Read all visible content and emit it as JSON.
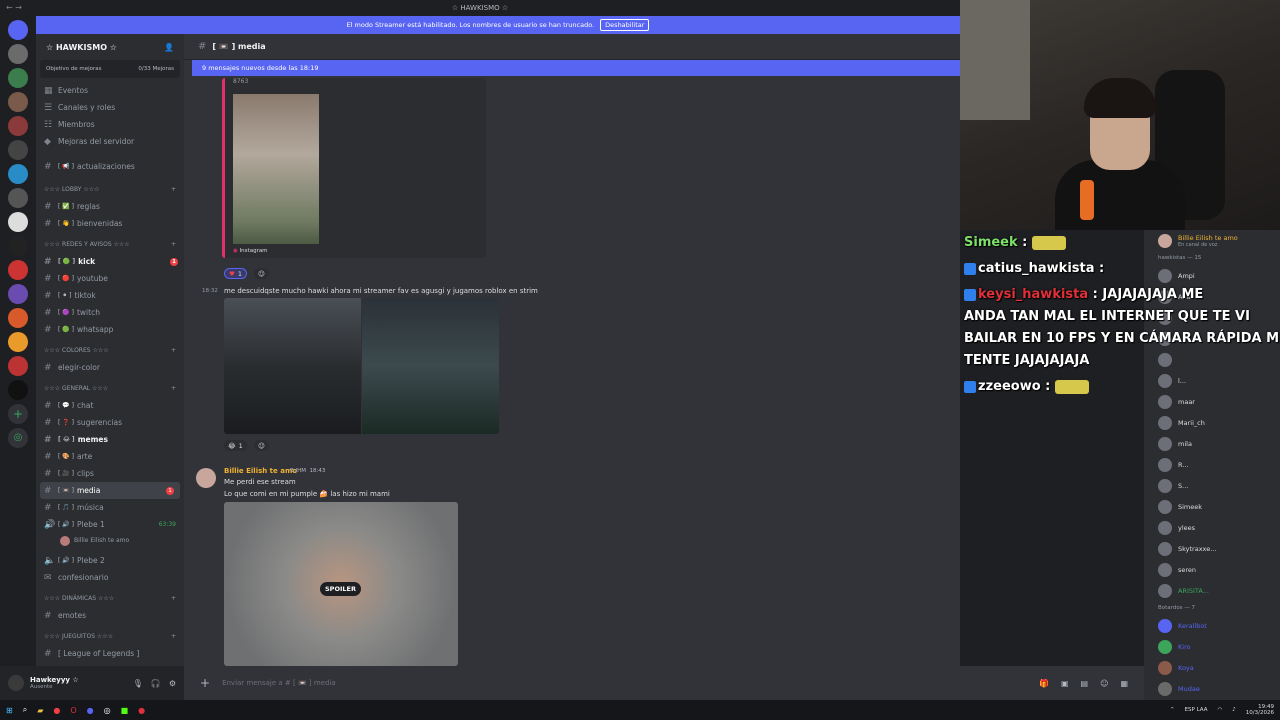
{
  "window": {
    "title": "☆ HAWKISMO ☆"
  },
  "streamer_bar": {
    "text": "El modo Streamer está habilitado. Los nombres de usuario se han truncado.",
    "button": "Deshabilitar"
  },
  "sidebar": {
    "server_name": "☆ HAWKISMO ☆",
    "goal_label": "Objetivo de mejoras",
    "goal_progress": "0/33 Mejoras",
    "menu": [
      "Eventos",
      "Canales y roles",
      "Miembros",
      "Mejoras del servidor"
    ],
    "channels_top": [
      {
        "name": "actualizaciones",
        "emoji": "[ 📢 ]"
      }
    ],
    "categories": [
      {
        "name": "☆☆☆ LOBBY ☆☆☆",
        "channels": [
          {
            "name": "reglas",
            "emoji": "[ ✅ ]"
          },
          {
            "name": "bienvenidas",
            "emoji": "[ 👋 ]"
          }
        ]
      },
      {
        "name": "☆☆☆ REDES Y AVISOS ☆☆☆",
        "channels": [
          {
            "name": "kick",
            "emoji": "[ 🟢 ]",
            "badge": "1"
          },
          {
            "name": "youtube",
            "emoji": "[ 🔴 ]"
          },
          {
            "name": "tiktok",
            "emoji": "[ ⚫ ]"
          },
          {
            "name": "twitch",
            "emoji": "[ 🟣 ]"
          },
          {
            "name": "whatsapp",
            "emoji": "[ 🟢 ]"
          }
        ]
      },
      {
        "name": "☆☆☆ COLORES ☆☆☆",
        "channels": [
          {
            "name": "elegir-color",
            "emoji": ""
          }
        ]
      },
      {
        "name": "☆☆☆ GENERAL ☆☆☆",
        "channels": [
          {
            "name": "chat",
            "emoji": "[ 💬 ]"
          },
          {
            "name": "sugerencias",
            "emoji": "[ ❓ ]"
          },
          {
            "name": "memes",
            "emoji": "[ 😂 ]"
          },
          {
            "name": "arte",
            "emoji": "[ 🎨 ]"
          },
          {
            "name": "clips",
            "emoji": "[ 🎥 ]"
          },
          {
            "name": "media",
            "emoji": "[ 📼 ]",
            "badge": "1"
          },
          {
            "name": "música",
            "emoji": "[ 🎵 ]"
          }
        ]
      }
    ],
    "voice": [
      {
        "name": "Plebe 1",
        "emoji": "[ 🔊 ]",
        "timer": "63:39",
        "member": "Billie Eilish te amo"
      },
      {
        "name": "Plebe 2",
        "emoji": "[ 🔊 ]"
      },
      {
        "name": "confesionario",
        "emoji": ""
      }
    ],
    "cat_dinamicas": "☆☆☆ DINÁMICAS ☆☆☆",
    "ch_emotes": "emotes",
    "cat_juegos": "☆☆☆ JUEGUITOS ☆☆☆",
    "ch_lol": "[ League of Legends ]"
  },
  "user_panel": {
    "name": "Hawkeyyy ☆",
    "status": "Ausente"
  },
  "channel": {
    "name": "[ 📼 ] media",
    "new_messages": "9 mensajes nuevos desde las 18:19",
    "composer_placeholder": "Enviar mensaje a #  [ 📼 ] media"
  },
  "messages": {
    "embed_code": "8763",
    "embed_source": "Instagram",
    "reaction1": "1",
    "time2": "18:32",
    "text2": "me descuidqste mucho hawki ahora mi streamer fav es agusgi y jugamos roblox en strim",
    "reaction2": "1",
    "author3": "Billie Eilish te amo",
    "author3_tag": "B.JHM",
    "time3": "18:43",
    "text3a": "Me perdi ese stream",
    "text3b": "Lo que comi en mi pumple 🍰 las hizo mi mami",
    "spoiler": "SPOILER"
  },
  "overlay_chat": [
    {
      "user": "Simeek",
      "text": ""
    },
    {
      "user": "catius_hawkista",
      "text": ""
    },
    {
      "user": "keysi_hawkista",
      "text": "JAJAJAJAJA ME"
    },
    {
      "user": "",
      "text": "ANDA TAN MAL EL INTERNET QUE TE VI"
    },
    {
      "user": "",
      "text": "BAILAR EN 10 FPS Y EN CÁMARA RÁPIDA ME"
    },
    {
      "user": "",
      "text": "TENTE JAJAJAJAJA"
    },
    {
      "user": "zzeeowo",
      "text": ""
    }
  ],
  "members": {
    "top": {
      "name": "Billie Eilish te amo",
      "sub": "En canal de voz"
    },
    "section1": "hawkistas — 15",
    "list": [
      "Ampi",
      "Ana",
      "",
      "",
      "",
      "l...",
      "maar",
      "Marii_ch",
      "mila",
      "R...",
      "S...",
      "Simeek",
      "ylees",
      "Skytraxxe...",
      "seren",
      "ARISITA..."
    ],
    "section2": "Botardos — 7",
    "bots": [
      "Kerallbot",
      "Kiro",
      "Koya",
      "Mudae"
    ]
  },
  "taskbar": {
    "lang": "ESP LAA",
    "time": "19:49",
    "date": "10/3/2026"
  }
}
